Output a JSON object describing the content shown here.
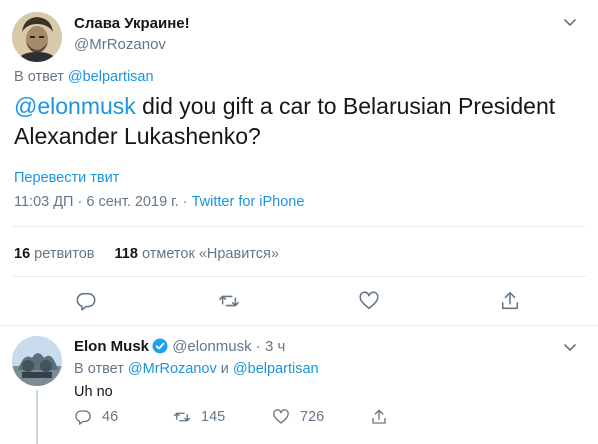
{
  "main_tweet": {
    "author_name": "Слава Украине!",
    "author_handle": "@MrRozanov",
    "reply_prefix": "В ответ",
    "reply_to": "@belpartisan",
    "mention": "@elonmusk",
    "text_body": " did you gift a car to Belarusian President Alexander Lukashenko?",
    "translate_label": "Перевести твит",
    "time": "11:03 ДП · 6 сент. 2019 г.",
    "meta_separator": " · ",
    "source": "Twitter for iPhone",
    "retweets_count": "16",
    "retweets_label": "ретвитов",
    "likes_count": "118",
    "likes_label": "отметок «Нравится»"
  },
  "reply_tweet": {
    "author_name": "Elon Musk",
    "author_handle": "@elonmusk",
    "time_ago": "· 3 ч",
    "reply_prefix": "В ответ",
    "reply_to_1": "@MrRozanov",
    "reply_and": "и",
    "reply_to_2": "@belpartisan",
    "text": "Uh no",
    "replies_count": "46",
    "retweets_count": "145",
    "likes_count": "726"
  },
  "icons": {
    "caret": "chevron-down-icon",
    "reply": "reply-icon",
    "retweet": "retweet-icon",
    "like": "heart-icon",
    "share": "share-icon",
    "verified": "verified-badge-icon"
  },
  "colors": {
    "link": "#1b95e0",
    "muted": "#657786",
    "text": "#14171a",
    "divider": "#e6ecf0",
    "verified": "#1da1f2"
  }
}
